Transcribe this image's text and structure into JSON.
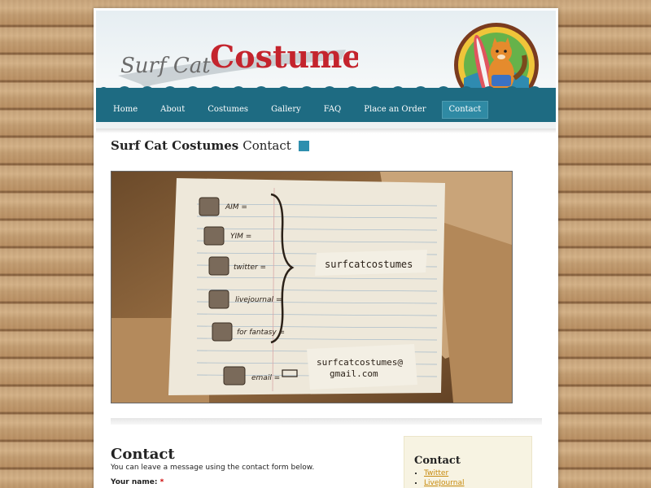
{
  "site": {
    "logo_text_part1": "Surf Cat",
    "logo_text_part2": "Costumes",
    "colors": {
      "nav": "#1e6b82",
      "nav_active": "#2f8aa4",
      "accent_square": "#2e8fae",
      "link": "#c78a0e",
      "logo_red": "#c4242d",
      "logo_gray": "#6b6b6b"
    }
  },
  "nav": {
    "items": [
      {
        "label": "Home"
      },
      {
        "label": "About"
      },
      {
        "label": "Costumes"
      },
      {
        "label": "Gallery"
      },
      {
        "label": "FAQ"
      },
      {
        "label": "Place an Order"
      },
      {
        "label": "Contact",
        "active": true
      }
    ]
  },
  "page_title": {
    "bold": "Surf Cat Costumes",
    "rest": "Contact"
  },
  "hero": {
    "rows": [
      {
        "label": "AIM ="
      },
      {
        "label": "YIM ="
      },
      {
        "label": "twitter ="
      },
      {
        "label": "livejournal ="
      },
      {
        "label": "for fantasy ="
      },
      {
        "label": "email ="
      }
    ],
    "handle": "surfcatcostumes",
    "email_line1": "surfcatcostumes@",
    "email_line2": "gmail.com"
  },
  "contact": {
    "heading": "Contact",
    "description": "You can leave a message using the contact form below.",
    "name_label": "Your name:",
    "required_mark": "*"
  },
  "sidebar": {
    "heading": "Contact",
    "links": [
      {
        "label": "Twitter"
      },
      {
        "label": "LiveJournal"
      }
    ]
  }
}
